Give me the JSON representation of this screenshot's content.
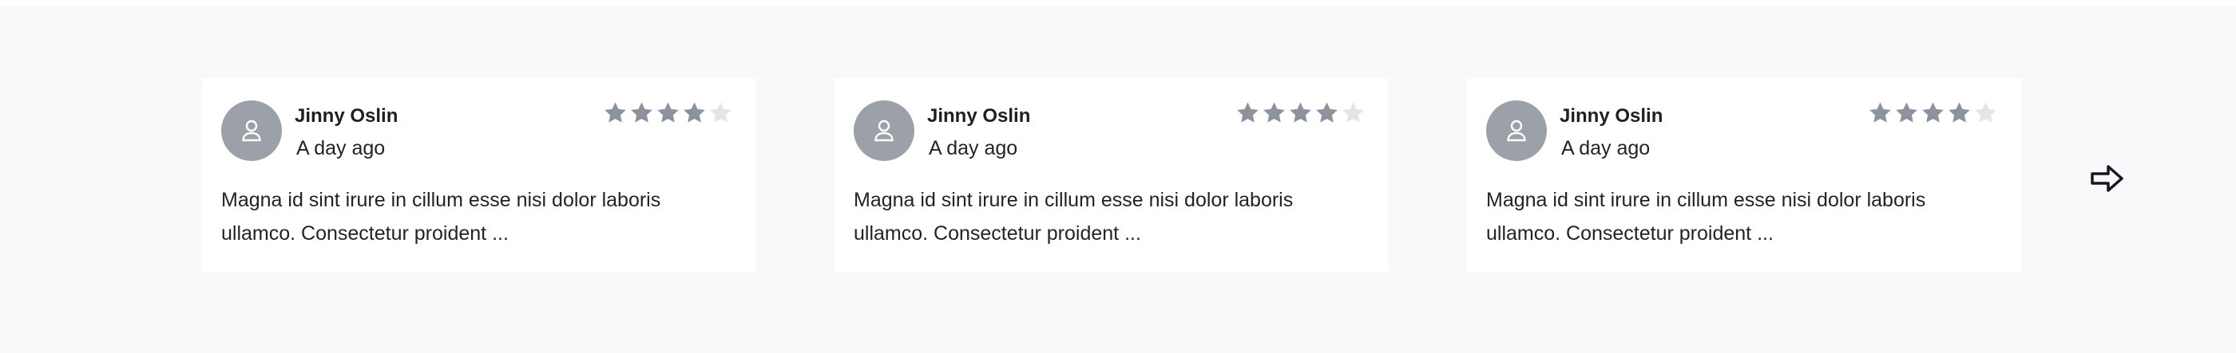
{
  "reviews": [
    {
      "name": "Jinny Oslin",
      "time": "A day ago",
      "rating": 4,
      "max_rating": 5,
      "text": "Magna id sint irure in cillum esse nisi dolor laboris ullamco. Consectetur proident ..."
    },
    {
      "name": "Jinny Oslin",
      "time": "A day ago",
      "rating": 4,
      "max_rating": 5,
      "text": "Magna id sint irure in cillum esse nisi dolor laboris ullamco. Consectetur proident ..."
    },
    {
      "name": "Jinny Oslin",
      "time": "A day ago",
      "rating": 4,
      "max_rating": 5,
      "text": "Magna id sint irure in cillum esse nisi dolor laboris ullamco. Consectetur proident ..."
    }
  ],
  "icons": {
    "avatar": "user-icon",
    "star": "star-icon",
    "next": "arrow-right-icon"
  },
  "colors": {
    "background": "#f8f9fb",
    "card": "#ffffff",
    "avatar": "#9ca0a8",
    "star_filled": "#8d939c",
    "star_empty": "#e3e5e9",
    "text": "#1f2329"
  }
}
